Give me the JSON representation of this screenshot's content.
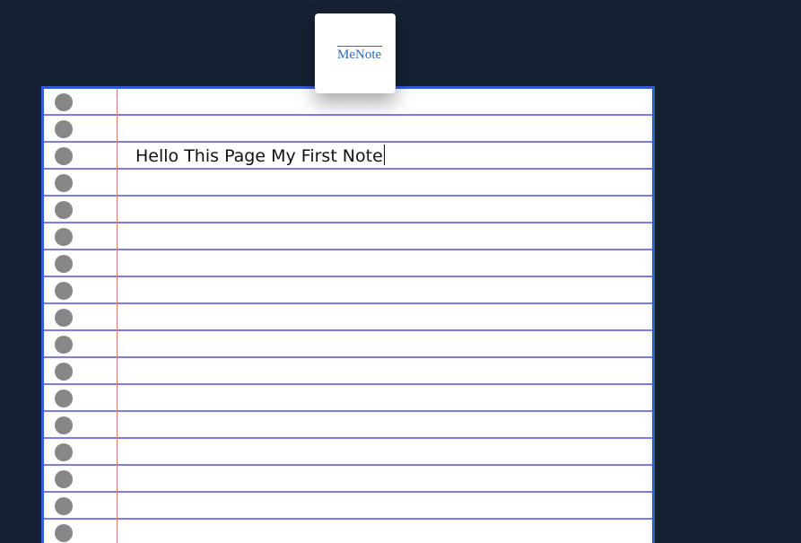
{
  "app": {
    "logo_text": "MeNote"
  },
  "note": {
    "text": "Hello This Page My First Note"
  },
  "theme": {
    "background": "#142233",
    "paper": "#ffffff",
    "rule_line": "#7b7bec",
    "margin_line": "#e07a7a",
    "border": "#2f5fd0",
    "hole": "#878787",
    "logo_accent": "#2b6bbd"
  },
  "icons": {
    "binder_hole": "circle"
  }
}
